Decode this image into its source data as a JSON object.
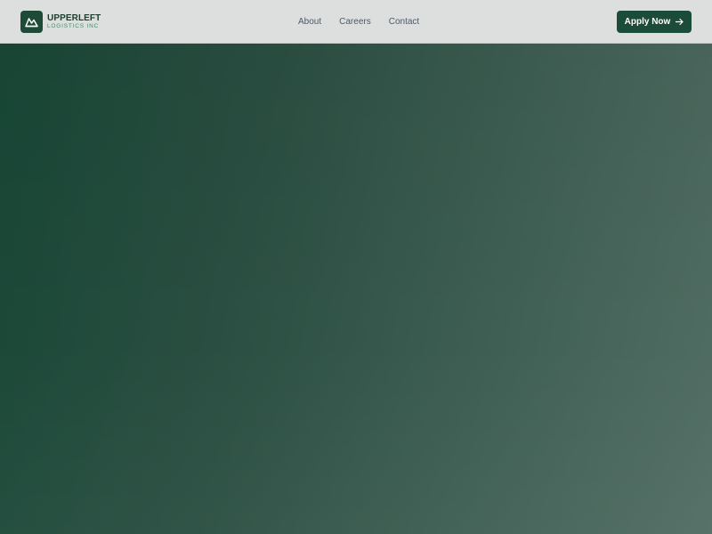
{
  "header": {
    "brand": {
      "name": "UPPERLEFT",
      "subtitle": "LOGISTICS INC",
      "icon": "mountain-icon"
    },
    "nav": [
      {
        "label": "About"
      },
      {
        "label": "Careers"
      },
      {
        "label": "Contact"
      }
    ],
    "cta": {
      "label": "Apply Now",
      "icon": "arrow-right-icon"
    }
  },
  "colors": {
    "brand_dark": "#1b4c39",
    "header_bg": "#dcdfdd",
    "hero_start": "#184736",
    "hero_end": "#526e64",
    "nav_text": "#4f5966"
  }
}
